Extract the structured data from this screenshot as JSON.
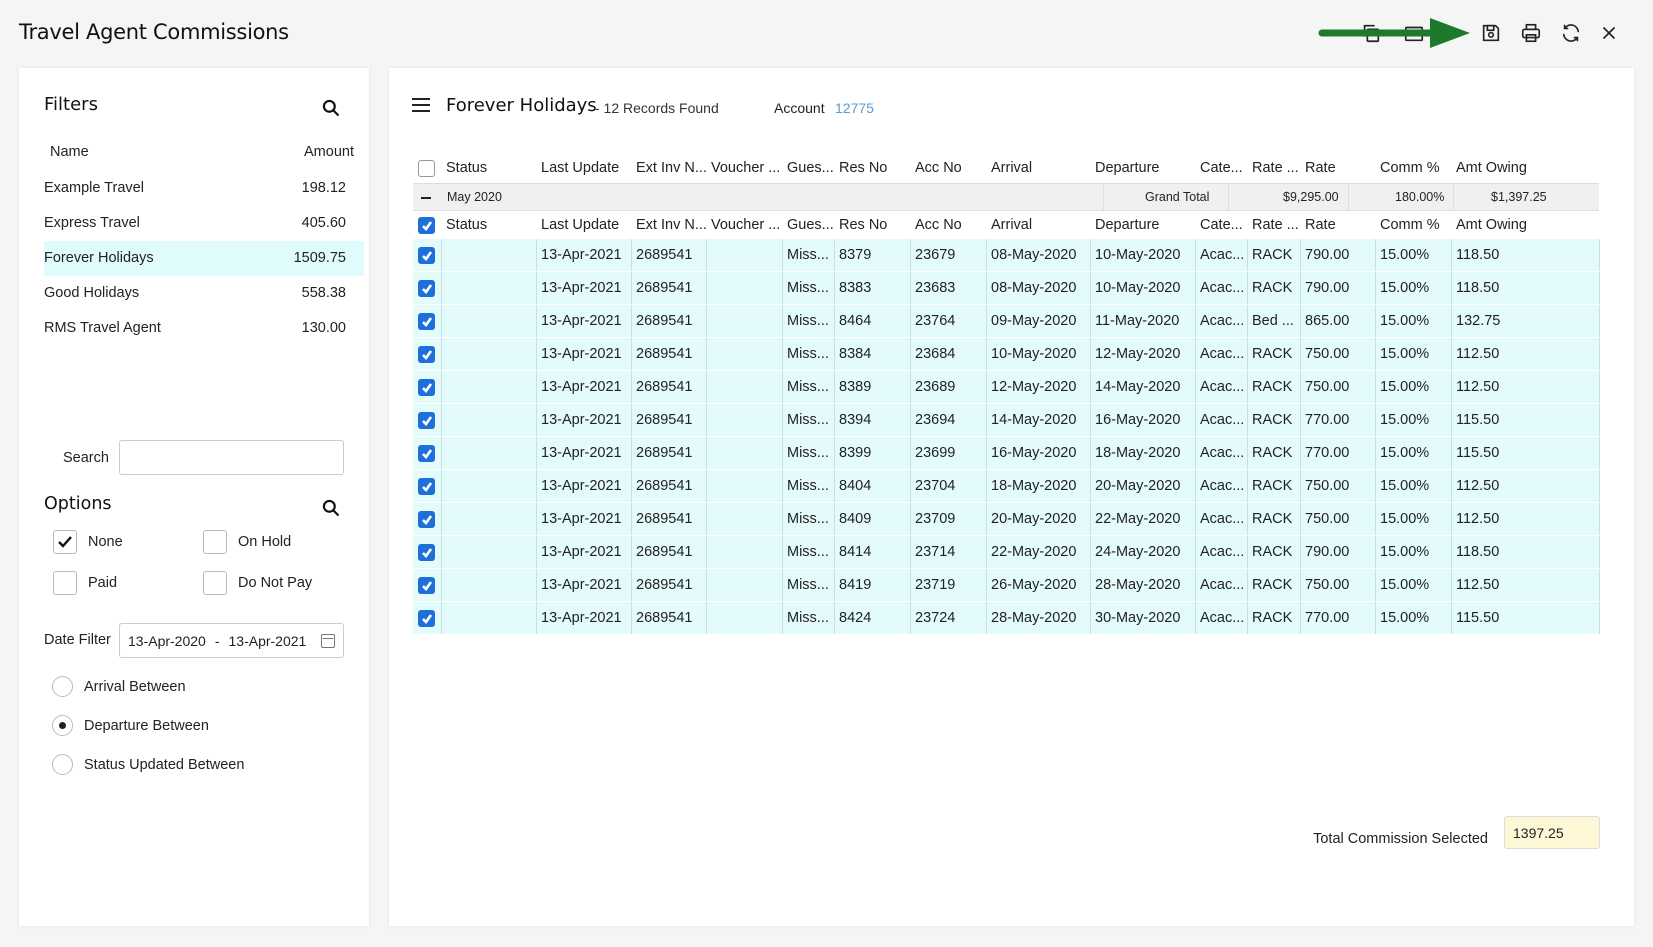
{
  "app": {
    "title": "Travel Agent Commissions"
  },
  "toolbar": {
    "icons": [
      "copy-icon",
      "export-icon",
      "save-icon",
      "print-icon",
      "refresh-icon",
      "close-icon"
    ],
    "annotation_arrow_color": "#1d7a2b"
  },
  "filters": {
    "title": "Filters",
    "col_name": "Name",
    "col_amount": "Amount",
    "agents": [
      {
        "name": "Example Travel",
        "amount": "198.12"
      },
      {
        "name": "Express Travel",
        "amount": "405.60"
      },
      {
        "name": "Forever Holidays",
        "amount": "1509.75"
      },
      {
        "name": "Good Holidays",
        "amount": "558.38"
      },
      {
        "name": "RMS Travel Agent",
        "amount": "130.00"
      }
    ],
    "selected_index": 2,
    "search_label": "Search",
    "search_value": "",
    "options_title": "Options",
    "options": [
      {
        "label": "None",
        "checked": true
      },
      {
        "label": "On Hold",
        "checked": false
      },
      {
        "label": "Paid",
        "checked": false
      },
      {
        "label": "Do Not Pay",
        "checked": false
      }
    ],
    "date_filter_label": "Date Filter",
    "date_from": "13-Apr-2020",
    "date_sep": "-",
    "date_to": "13-Apr-2021",
    "date_modes": [
      {
        "label": "Arrival Between",
        "selected": false
      },
      {
        "label": "Departure Between",
        "selected": true
      },
      {
        "label": "Status Updated Between",
        "selected": false
      }
    ]
  },
  "main": {
    "agent_title": "Forever Holidays",
    "records": "- 12 Records Found",
    "account_label": "Account",
    "account_value": "12775",
    "columns": [
      "Status",
      "Last Update",
      "Ext Inv N...",
      "Voucher ...",
      "Gues...",
      "Res No",
      "Acc No",
      "Arrival",
      "Departure",
      "Cate...",
      "Rate ...",
      "Rate",
      "Comm %",
      "Amt Owing"
    ],
    "group": {
      "label": "May 2020",
      "total_label": "Grand Total",
      "total_rate": "$9,295.00",
      "total_comm": "180.00%",
      "total_owing": "$1,397.25"
    },
    "rows": [
      {
        "status": "",
        "last_update": "13-Apr-2021",
        "ext_inv": "2689541",
        "voucher": "",
        "guest": "Miss...",
        "res_no": "8379",
        "acc_no": "23679",
        "arrival": "08-May-2020",
        "departure": "10-May-2020",
        "category": "Acac...",
        "rate_type": "RACK",
        "rate": "790.00",
        "comm": "15.00%",
        "owing": "118.50"
      },
      {
        "status": "",
        "last_update": "13-Apr-2021",
        "ext_inv": "2689541",
        "voucher": "",
        "guest": "Miss...",
        "res_no": "8383",
        "acc_no": "23683",
        "arrival": "08-May-2020",
        "departure": "10-May-2020",
        "category": "Acac...",
        "rate_type": "RACK",
        "rate": "790.00",
        "comm": "15.00%",
        "owing": "118.50"
      },
      {
        "status": "",
        "last_update": "13-Apr-2021",
        "ext_inv": "2689541",
        "voucher": "",
        "guest": "Miss...",
        "res_no": "8464",
        "acc_no": "23764",
        "arrival": "09-May-2020",
        "departure": "11-May-2020",
        "category": "Acac...",
        "rate_type": "Bed ...",
        "rate": "865.00",
        "comm": "15.00%",
        "owing": "132.75"
      },
      {
        "status": "",
        "last_update": "13-Apr-2021",
        "ext_inv": "2689541",
        "voucher": "",
        "guest": "Miss...",
        "res_no": "8384",
        "acc_no": "23684",
        "arrival": "10-May-2020",
        "departure": "12-May-2020",
        "category": "Acac...",
        "rate_type": "RACK",
        "rate": "750.00",
        "comm": "15.00%",
        "owing": "112.50"
      },
      {
        "status": "",
        "last_update": "13-Apr-2021",
        "ext_inv": "2689541",
        "voucher": "",
        "guest": "Miss...",
        "res_no": "8389",
        "acc_no": "23689",
        "arrival": "12-May-2020",
        "departure": "14-May-2020",
        "category": "Acac...",
        "rate_type": "RACK",
        "rate": "750.00",
        "comm": "15.00%",
        "owing": "112.50"
      },
      {
        "status": "",
        "last_update": "13-Apr-2021",
        "ext_inv": "2689541",
        "voucher": "",
        "guest": "Miss...",
        "res_no": "8394",
        "acc_no": "23694",
        "arrival": "14-May-2020",
        "departure": "16-May-2020",
        "category": "Acac...",
        "rate_type": "RACK",
        "rate": "770.00",
        "comm": "15.00%",
        "owing": "115.50"
      },
      {
        "status": "",
        "last_update": "13-Apr-2021",
        "ext_inv": "2689541",
        "voucher": "",
        "guest": "Miss...",
        "res_no": "8399",
        "acc_no": "23699",
        "arrival": "16-May-2020",
        "departure": "18-May-2020",
        "category": "Acac...",
        "rate_type": "RACK",
        "rate": "770.00",
        "comm": "15.00%",
        "owing": "115.50"
      },
      {
        "status": "",
        "last_update": "13-Apr-2021",
        "ext_inv": "2689541",
        "voucher": "",
        "guest": "Miss...",
        "res_no": "8404",
        "acc_no": "23704",
        "arrival": "18-May-2020",
        "departure": "20-May-2020",
        "category": "Acac...",
        "rate_type": "RACK",
        "rate": "750.00",
        "comm": "15.00%",
        "owing": "112.50"
      },
      {
        "status": "",
        "last_update": "13-Apr-2021",
        "ext_inv": "2689541",
        "voucher": "",
        "guest": "Miss...",
        "res_no": "8409",
        "acc_no": "23709",
        "arrival": "20-May-2020",
        "departure": "22-May-2020",
        "category": "Acac...",
        "rate_type": "RACK",
        "rate": "750.00",
        "comm": "15.00%",
        "owing": "112.50"
      },
      {
        "status": "",
        "last_update": "13-Apr-2021",
        "ext_inv": "2689541",
        "voucher": "",
        "guest": "Miss...",
        "res_no": "8414",
        "acc_no": "23714",
        "arrival": "22-May-2020",
        "departure": "24-May-2020",
        "category": "Acac...",
        "rate_type": "RACK",
        "rate": "790.00",
        "comm": "15.00%",
        "owing": "118.50"
      },
      {
        "status": "",
        "last_update": "13-Apr-2021",
        "ext_inv": "2689541",
        "voucher": "",
        "guest": "Miss...",
        "res_no": "8419",
        "acc_no": "23719",
        "arrival": "26-May-2020",
        "departure": "28-May-2020",
        "category": "Acac...",
        "rate_type": "RACK",
        "rate": "750.00",
        "comm": "15.00%",
        "owing": "112.50"
      },
      {
        "status": "",
        "last_update": "13-Apr-2021",
        "ext_inv": "2689541",
        "voucher": "",
        "guest": "Miss...",
        "res_no": "8424",
        "acc_no": "23724",
        "arrival": "28-May-2020",
        "departure": "30-May-2020",
        "category": "Acac...",
        "rate_type": "RACK",
        "rate": "770.00",
        "comm": "15.00%",
        "owing": "115.50"
      }
    ],
    "total_label": "Total Commission Selected",
    "total_value": "1397.25",
    "colors": {
      "row_bg": "#e4fbfc",
      "link": "#5a9bd5",
      "check": "#1e6fd9",
      "total_bg": "#fef8d6"
    }
  }
}
